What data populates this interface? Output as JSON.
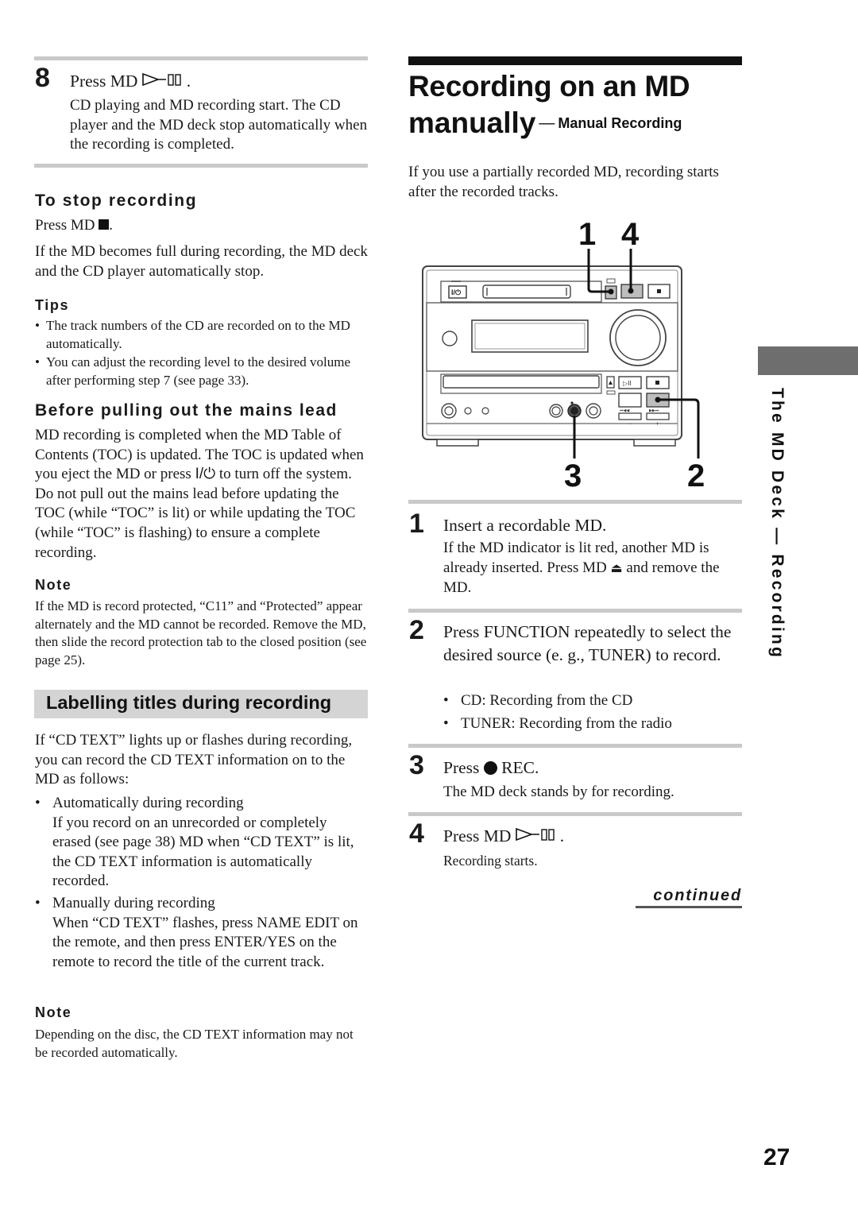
{
  "left": {
    "step8": {
      "number": "8",
      "title_prefix": "Press MD",
      "title_suffix": ".",
      "body": "CD playing and MD recording start. The CD player and the MD deck stop automatically when the recording is completed."
    },
    "stop_recording": {
      "heading": "To stop recording",
      "press_prefix": "Press MD",
      "press_suffix": ".",
      "body": "If the MD becomes full during recording, the MD deck and the CD player automatically stop."
    },
    "tips": {
      "heading": "Tips",
      "items": [
        "The track numbers of the CD are recorded on to the MD automatically.",
        "You can adjust the recording level to the desired volume after performing step 7 (see page 33)."
      ]
    },
    "mains_lead": {
      "heading": "Before pulling out the mains lead",
      "body_before_icon": "MD recording is completed when the MD Table of Contents (TOC) is updated. The TOC is updated when you eject the MD or press",
      "power_symbol": "I/⏻",
      "body_after_icon": "to turn off the system. Do not pull out the mains lead before updating the TOC (while “TOC” is lit) or while updating the TOC (while “TOC” is flashing) to ensure a complete recording."
    },
    "note1": {
      "heading": "Note",
      "body": "If the MD is record protected, “C11” and “Protected” appear alternately and the MD cannot be recorded. Remove the MD, then slide the record protection tab to the closed position (see page 25)."
    },
    "labelling": {
      "heading": "Labelling titles during recording",
      "intro": "If “CD TEXT” lights up or flashes during recording, you can record the CD TEXT information on to the MD as follows:",
      "items": [
        {
          "title": "Automatically during recording",
          "body": "If you record on an unrecorded or completely erased (see page 38) MD when “CD TEXT” is lit, the CD TEXT information is automatically recorded."
        },
        {
          "title": "Manually during recording",
          "body": "When “CD TEXT” flashes, press NAME EDIT on the remote, and then press ENTER/YES on the remote to record the title of the current track."
        }
      ]
    },
    "note2": {
      "heading": "Note",
      "body": "Depending on the disc, the CD TEXT information may not be recorded automatically."
    }
  },
  "right": {
    "title_line1": "Recording on an MD",
    "title_line2": "manually",
    "title_dash": "—",
    "subtitle": "Manual Recording",
    "intro": "If you use a partially recorded MD, recording starts after the recorded tracks.",
    "diagram": {
      "callouts": [
        "1",
        "4",
        "3",
        "2"
      ],
      "button_labels": {
        "power": "I/⏻",
        "stop": "■",
        "eject": "▲",
        "play_pause": "▷II",
        "prev": "⏮◀◀",
        "next": "▶▶⏭",
        "minus": "−",
        "plus": "+"
      }
    },
    "steps": [
      {
        "number": "1",
        "title": "Insert a recordable MD.",
        "body_before_icon": "If the MD indicator is lit red, another MD is already inserted. Press MD",
        "eject_symbol": "⏏",
        "body_after_icon": "and remove the MD."
      },
      {
        "number": "2",
        "title": "Press FUNCTION repeatedly to select the desired source (e. g., TUNER) to record.",
        "items": [
          "CD: Recording from the CD",
          "TUNER: Recording from the radio"
        ]
      },
      {
        "number": "3",
        "title_prefix": "Press",
        "title_suffix": "REC.",
        "body": "The MD deck stands by for recording."
      },
      {
        "number": "4",
        "title_prefix": "Press MD",
        "title_suffix": ".",
        "body": "Recording starts."
      }
    ],
    "continued": "continued"
  },
  "side_tab": {
    "label": "The MD Deck — Recording"
  },
  "page_number": "27",
  "colors": {
    "rule_gray": "#c9c9c9",
    "heading_band": "#d4d4d4",
    "side_tab_gray": "#6e6e6e",
    "button_highlight": "#bdbdbd"
  }
}
